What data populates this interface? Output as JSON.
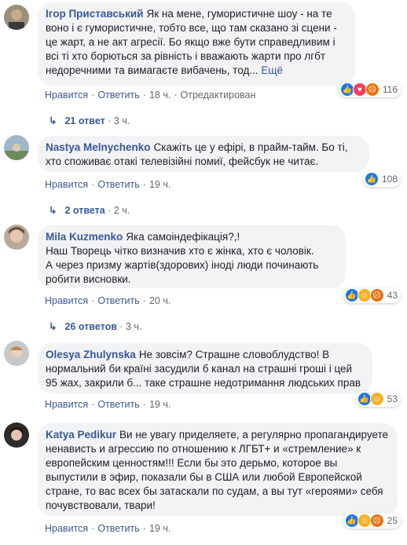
{
  "comments": [
    {
      "author": "Ігор Приставський",
      "text": "Як на мене, гумористичне шоу - на те воно і є гумористичне, тобто все, що там сказано зі сцени - це жарт, а не акт агресії. Бо якщо вже бути справедливим і всі ті хто борються за рівність і вважають жарти про лгбт недоречними та вимагаєте вибачень, тод...",
      "more": "Ещё",
      "like": "Нравится",
      "reply": "Ответить",
      "time": "18 ч.",
      "edited": "Отредактирован",
      "reaction_count": "116",
      "reactions": [
        "like",
        "love",
        "angry"
      ],
      "replies": "21 ответ",
      "replies_time": "3 ч."
    },
    {
      "author": "Nastya Melnychenko",
      "text": "Скажіть це у ефірі, в прайм-тайм. Бо ті, хто споживає отакі телевізійні помиї, фейсбук не читає.",
      "like": "Нравится",
      "reply": "Ответить",
      "time": "19 ч.",
      "reaction_count": "108",
      "reactions": [
        "like"
      ],
      "replies": "2 ответа",
      "replies_time": "2 ч."
    },
    {
      "author": "Mila Kuzmenko",
      "text1": "Яка самоіндефікація?,!",
      "text2": "Наш Творець чітко визначив хто є жінка, хто є чоловік.",
      "text3": "А через призму жартів(здорових) іноді люди починають робити висновки.",
      "like": "Нравится",
      "reply": "Ответить",
      "time": "20 ч.",
      "reaction_count": "43",
      "reactions": [
        "like",
        "haha",
        "angry"
      ],
      "replies": "26 ответов",
      "replies_time": "3 ч."
    },
    {
      "author": "Olesya Zhulynska",
      "text": "Не зовсім? Страшне словоблудство! В нормальний би країні засудили б канал на страшні гроші і цей 95 жах, закрили б... таке страшне недотримання людських прав",
      "like": "Нравится",
      "reply": "Ответить",
      "time": "19 ч.",
      "reaction_count": "53",
      "reactions": [
        "like",
        "haha"
      ]
    },
    {
      "author": "Katya Pedikur",
      "text": "Ви не увагу приделяете, а регулярно пропагандируете ненависть и агрессию по отношению к ЛГБТ+ и «стремление» к европейским ценностям!!! Если бы это дерьмо, которое вы выпустили в эфир, показали бы в США или любой Европейской стране, то вас всех бы затаскали по судам, а вы тут «героями» себя почувствовали, твари!",
      "like": "Нравится",
      "reply": "Ответить",
      "time": "19 ч.",
      "reaction_count": "25",
      "reactions": [
        "like",
        "haha",
        "angry"
      ]
    }
  ],
  "colors": {
    "link": "#385898",
    "bubble": "#f2f3f5",
    "meta": "#606770"
  }
}
